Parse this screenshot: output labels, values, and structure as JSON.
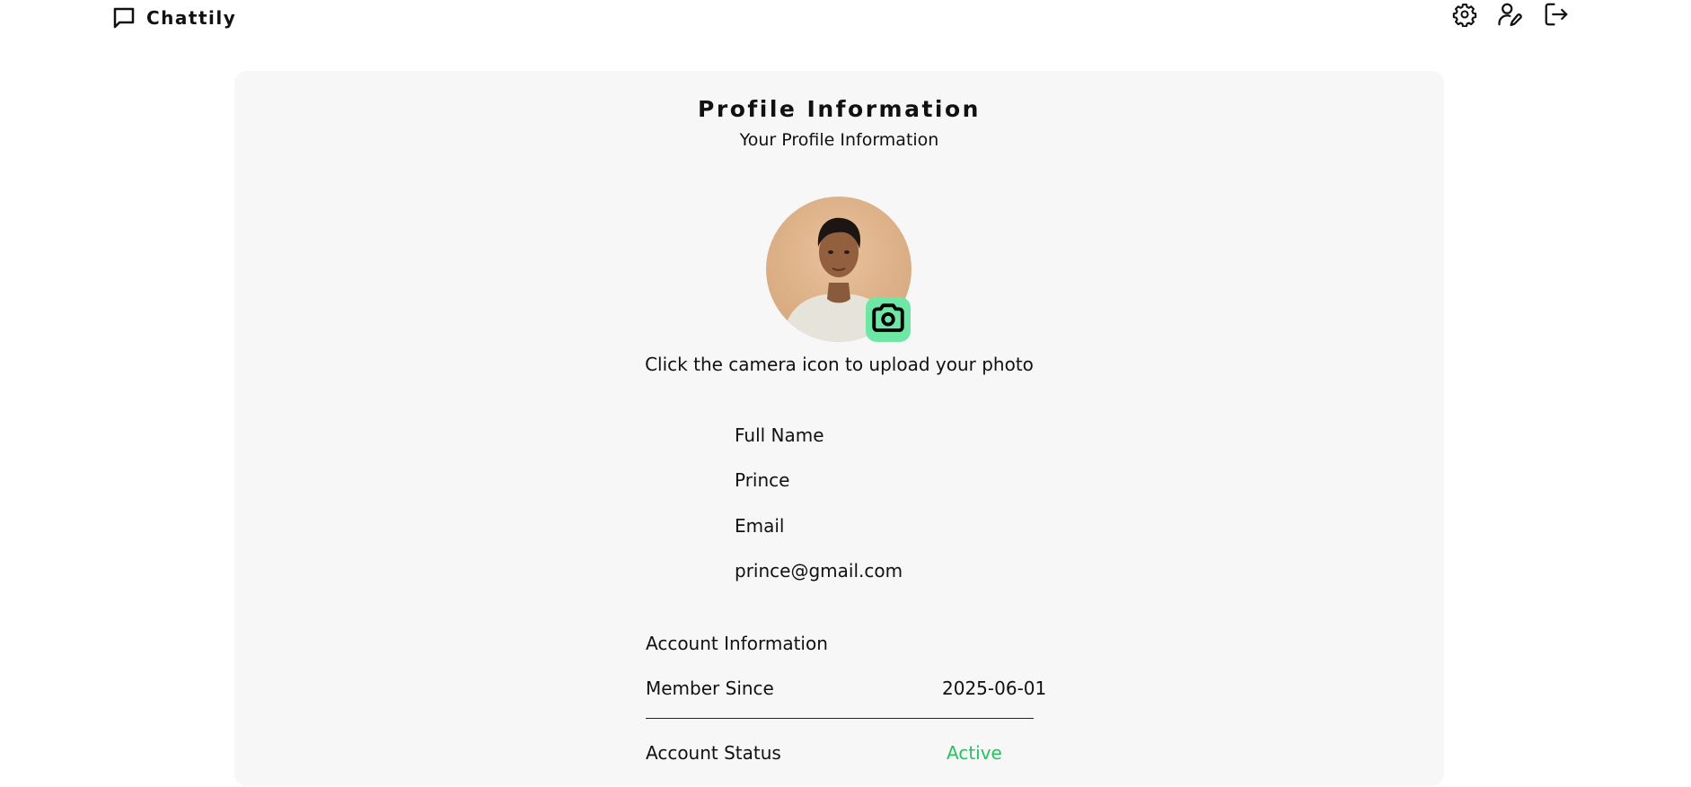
{
  "header": {
    "brand_name": "Chattily",
    "icons": [
      "chat-bubble-icon",
      "settings-icon",
      "edit-profile-icon",
      "logout-icon"
    ]
  },
  "profile": {
    "title": "Profile Information",
    "subtitle": "Your Profile Information",
    "upload_hint": "Click the camera icon to upload your photo",
    "camera_button_color": "#6ee7a4",
    "fields": [
      {
        "label": "Full Name",
        "value": "Prince"
      },
      {
        "label": "Email",
        "value": "prince@gmail.com"
      }
    ]
  },
  "account": {
    "title": "Account Information",
    "member_since_label": "Member Since",
    "member_since_value": "2025-06-01",
    "status_label": "Account Status",
    "status_value": "Active",
    "status_color": "#22c55e"
  }
}
